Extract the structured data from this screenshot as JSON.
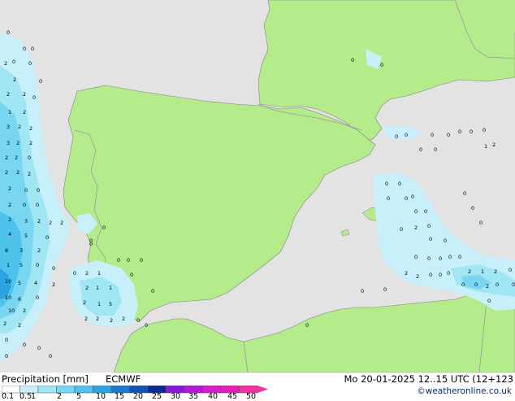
{
  "footer": {
    "title": "Precipitation [mm]",
    "model": "ECMWF",
    "valid_time": "Mo 20-01-2025 12..15 UTC (12+123",
    "credit": "©weatheronline.co.uk"
  },
  "legend": {
    "ticks": [
      "0.1",
      "0.5",
      "1",
      "2",
      "5",
      "10",
      "15",
      "20",
      "25",
      "30",
      "35",
      "40",
      "45",
      "50"
    ],
    "colors": [
      "#ffffff",
      "#c8f0fa",
      "#a0e6f5",
      "#78d6f0",
      "#50c3ec",
      "#2da4e2",
      "#1e78d2",
      "#1450b4",
      "#0a2891",
      "#8a18d8",
      "#b418d8",
      "#d81ec8",
      "#e61eb4",
      "#f032a0"
    ]
  },
  "map_colors": {
    "sea": "#e3e3e3",
    "land": "#b4ec8c",
    "border": "#9a9a9a",
    "coast": "#808080"
  },
  "precip_labels": [
    "0",
    "2",
    "1",
    "3",
    "5",
    "4",
    "6",
    "8",
    "10"
  ]
}
